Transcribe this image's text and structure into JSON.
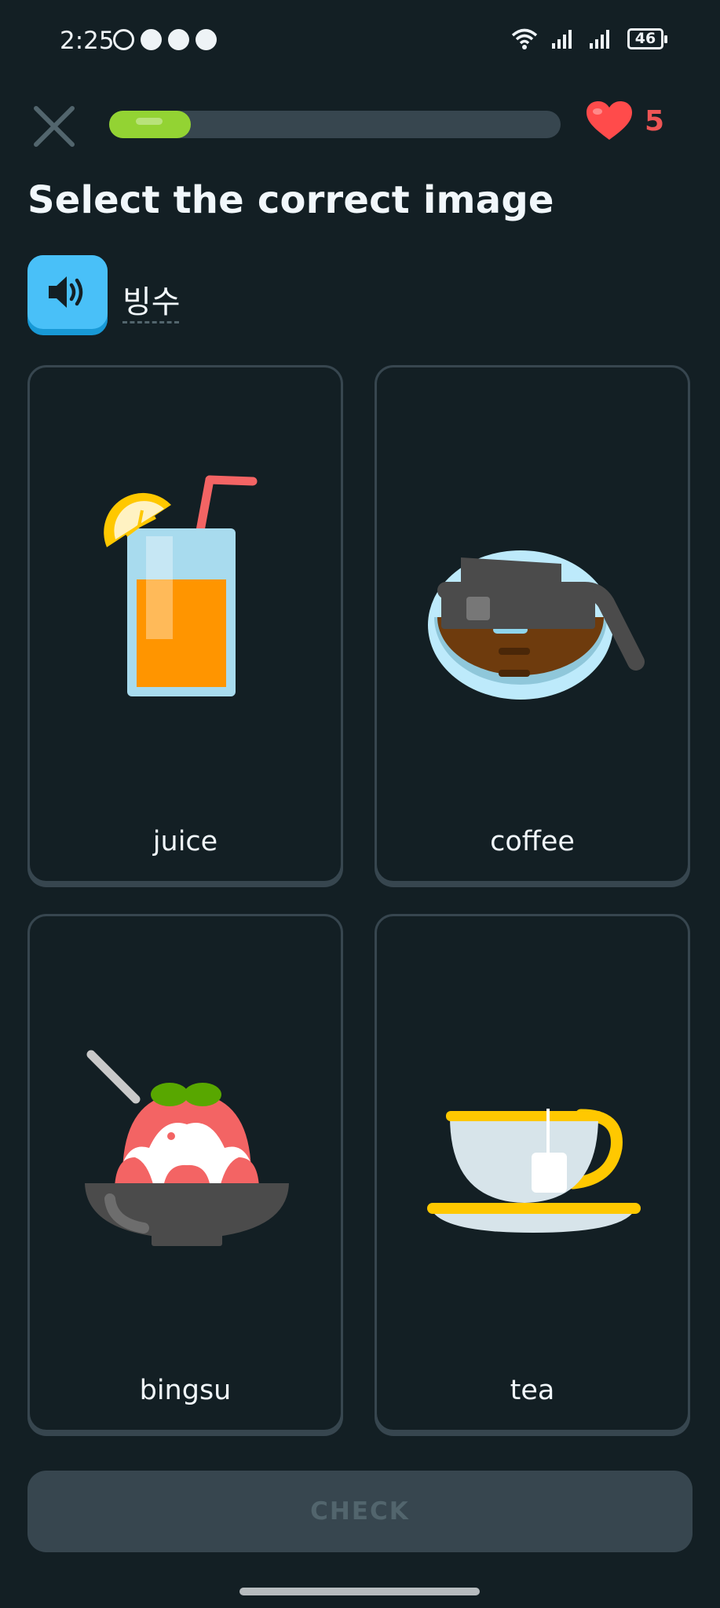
{
  "status_bar": {
    "time": "2:25",
    "app_icons": [
      "facebook-lite-icon",
      "facebook-icon",
      "messenger-icon",
      "messenger-icon"
    ],
    "battery": "46"
  },
  "header": {
    "progress_percent": 18,
    "hearts": "5",
    "accent_green": "#93d333",
    "heart_color": "#ff4b4b"
  },
  "exercise": {
    "title": "Select the correct image",
    "prompt": "빙수"
  },
  "options": [
    {
      "label": "juice",
      "icon": "juice-glass-icon"
    },
    {
      "label": "coffee",
      "icon": "coffee-pot-icon"
    },
    {
      "label": "bingsu",
      "icon": "bingsu-bowl-icon"
    },
    {
      "label": "tea",
      "icon": "teacup-icon"
    }
  ],
  "footer": {
    "check_label": "CHECK"
  }
}
